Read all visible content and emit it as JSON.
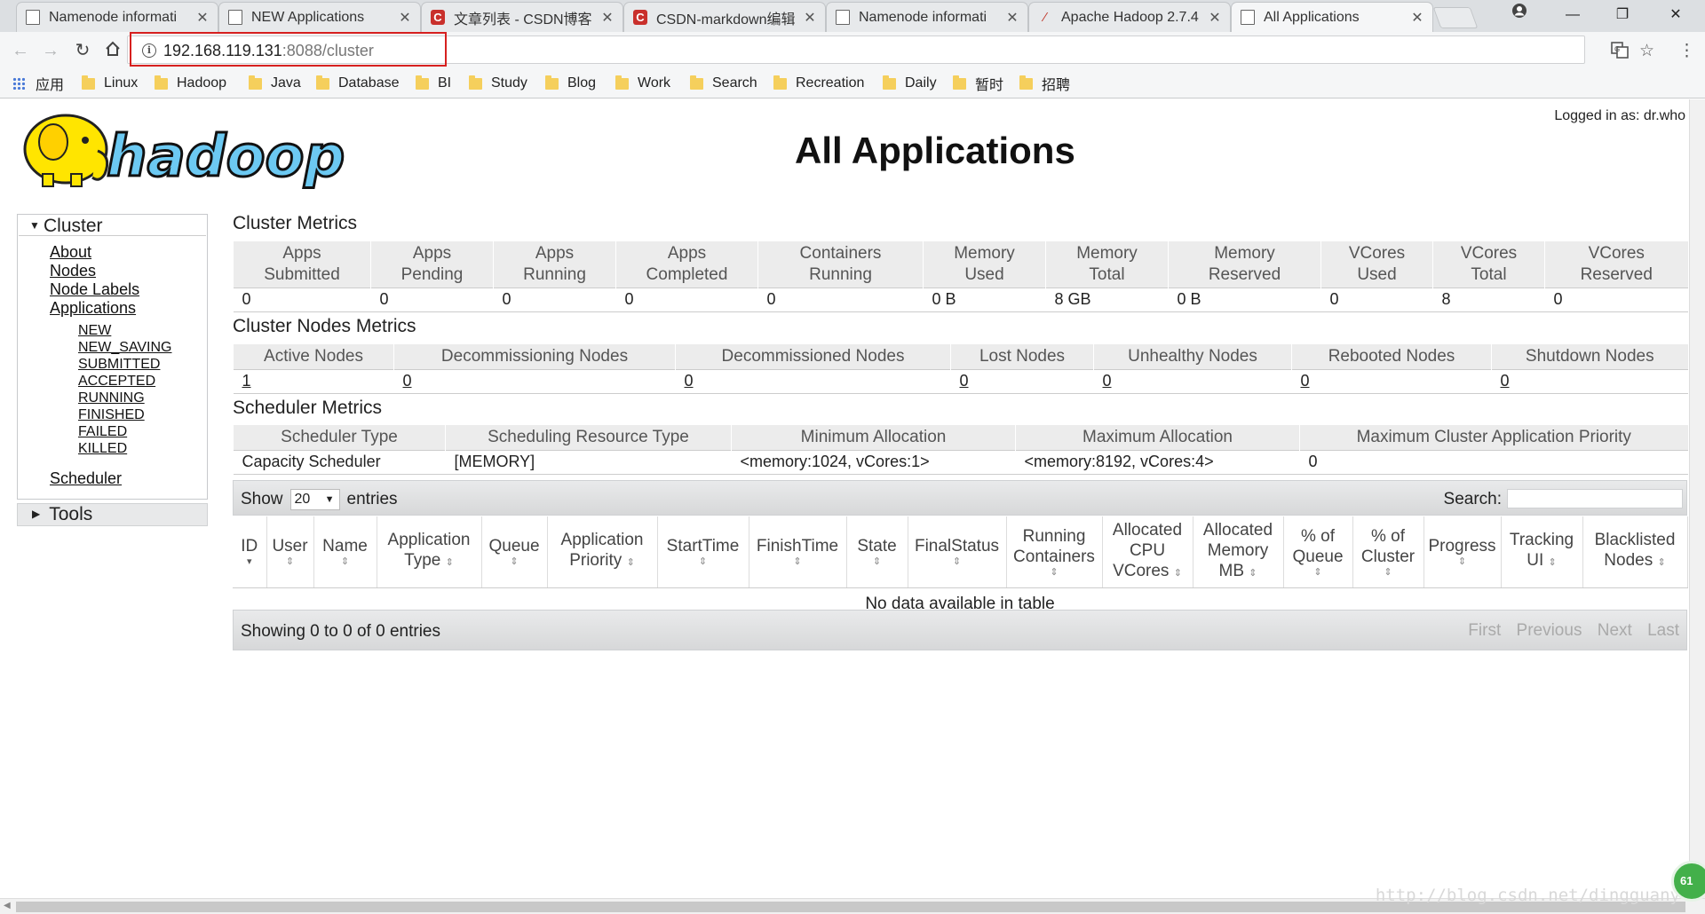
{
  "browser": {
    "tabs": [
      {
        "title": "Namenode informati",
        "icon": "document-icon"
      },
      {
        "title": "NEW Applications",
        "icon": "document-icon"
      },
      {
        "title": "文章列表 - CSDN博客",
        "icon": "csdn-icon"
      },
      {
        "title": "CSDN-markdown编辑",
        "icon": "csdn-icon"
      },
      {
        "title": "Namenode informati",
        "icon": "document-icon"
      },
      {
        "title": "Apache Hadoop 2.7.4",
        "icon": "apache-feather-icon"
      },
      {
        "title": "All Applications",
        "icon": "document-icon",
        "active": true
      }
    ],
    "url_host": "192.168.119.131",
    "url_rest": ":8088/cluster",
    "apps_label": "应用",
    "bookmarks": [
      "Linux",
      "Hadoop",
      "Java",
      "Database",
      "BI",
      "Study",
      "Blog",
      "Work",
      "Search",
      "Recreation",
      "Daily",
      "暂时",
      "招聘"
    ]
  },
  "page": {
    "logged_in": "Logged in as: dr.who",
    "title": "All Applications",
    "logo_text": "hadoop"
  },
  "nav": {
    "cluster": "Cluster",
    "about": "About",
    "nodes": "Nodes",
    "node_labels": "Node Labels",
    "applications": "Applications",
    "states": [
      "NEW",
      "NEW_SAVING",
      "SUBMITTED",
      "ACCEPTED",
      "RUNNING",
      "FINISHED",
      "FAILED",
      "KILLED"
    ],
    "scheduler": "Scheduler",
    "tools": "Tools"
  },
  "cluster_metrics": {
    "title": "Cluster Metrics",
    "headers": [
      [
        "Apps",
        "Submitted"
      ],
      [
        "Apps",
        "Pending"
      ],
      [
        "Apps",
        "Running"
      ],
      [
        "Apps",
        "Completed"
      ],
      [
        "Containers",
        "Running"
      ],
      [
        "Memory",
        "Used"
      ],
      [
        "Memory",
        "Total"
      ],
      [
        "Memory",
        "Reserved"
      ],
      [
        "VCores",
        "Used"
      ],
      [
        "VCores",
        "Total"
      ],
      [
        "VCores",
        "Reserved"
      ]
    ],
    "values": [
      "0",
      "0",
      "0",
      "0",
      "0",
      "0 B",
      "8 GB",
      "0 B",
      "0",
      "8",
      "0"
    ]
  },
  "cluster_nodes_metrics": {
    "title": "Cluster Nodes Metrics",
    "headers": [
      "Active Nodes",
      "Decommissioning Nodes",
      "Decommissioned Nodes",
      "Lost Nodes",
      "Unhealthy Nodes",
      "Rebooted Nodes",
      "Shutdown Nodes"
    ],
    "values": [
      "1",
      "0",
      "0",
      "0",
      "0",
      "0",
      "0"
    ]
  },
  "scheduler_metrics": {
    "title": "Scheduler Metrics",
    "headers": [
      "Scheduler Type",
      "Scheduling Resource Type",
      "Minimum Allocation",
      "Maximum Allocation",
      "Maximum Cluster Application Priority"
    ],
    "values": [
      "Capacity Scheduler",
      "[MEMORY]",
      "<memory:1024, vCores:1>",
      "<memory:8192, vCores:4>",
      "0"
    ]
  },
  "apps_table": {
    "show_label": "Show",
    "page_size": "20",
    "entries_label": "entries",
    "search_label": "Search:",
    "columns": [
      [
        "ID"
      ],
      [
        "User"
      ],
      [
        "Name"
      ],
      [
        "Application",
        "Type"
      ],
      [
        "Queue"
      ],
      [
        "Application",
        "Priority"
      ],
      [
        "StartTime"
      ],
      [
        "FinishTime"
      ],
      [
        "State"
      ],
      [
        "FinalStatus"
      ],
      [
        "Running",
        "Containers"
      ],
      [
        "Allocated",
        "CPU",
        "VCores"
      ],
      [
        "Allocated",
        "Memory",
        "MB"
      ],
      [
        "% of",
        "Queue"
      ],
      [
        "% of",
        "Cluster"
      ],
      [
        "Progress"
      ],
      [
        "Tracking",
        "UI"
      ],
      [
        "Blacklisted",
        "Nodes"
      ]
    ],
    "empty_message": "No data available in table",
    "info": "Showing 0 to 0 of 0 entries",
    "pager": [
      "First",
      "Previous",
      "Next",
      "Last"
    ]
  },
  "watermark": "http://blog.csdn.net/dingguany",
  "badge": "61",
  "colors": {
    "url_highlight": "#d6201f",
    "header_bg": "#ececec",
    "folder": "#f5cf5c",
    "badge": "#43b04a"
  }
}
